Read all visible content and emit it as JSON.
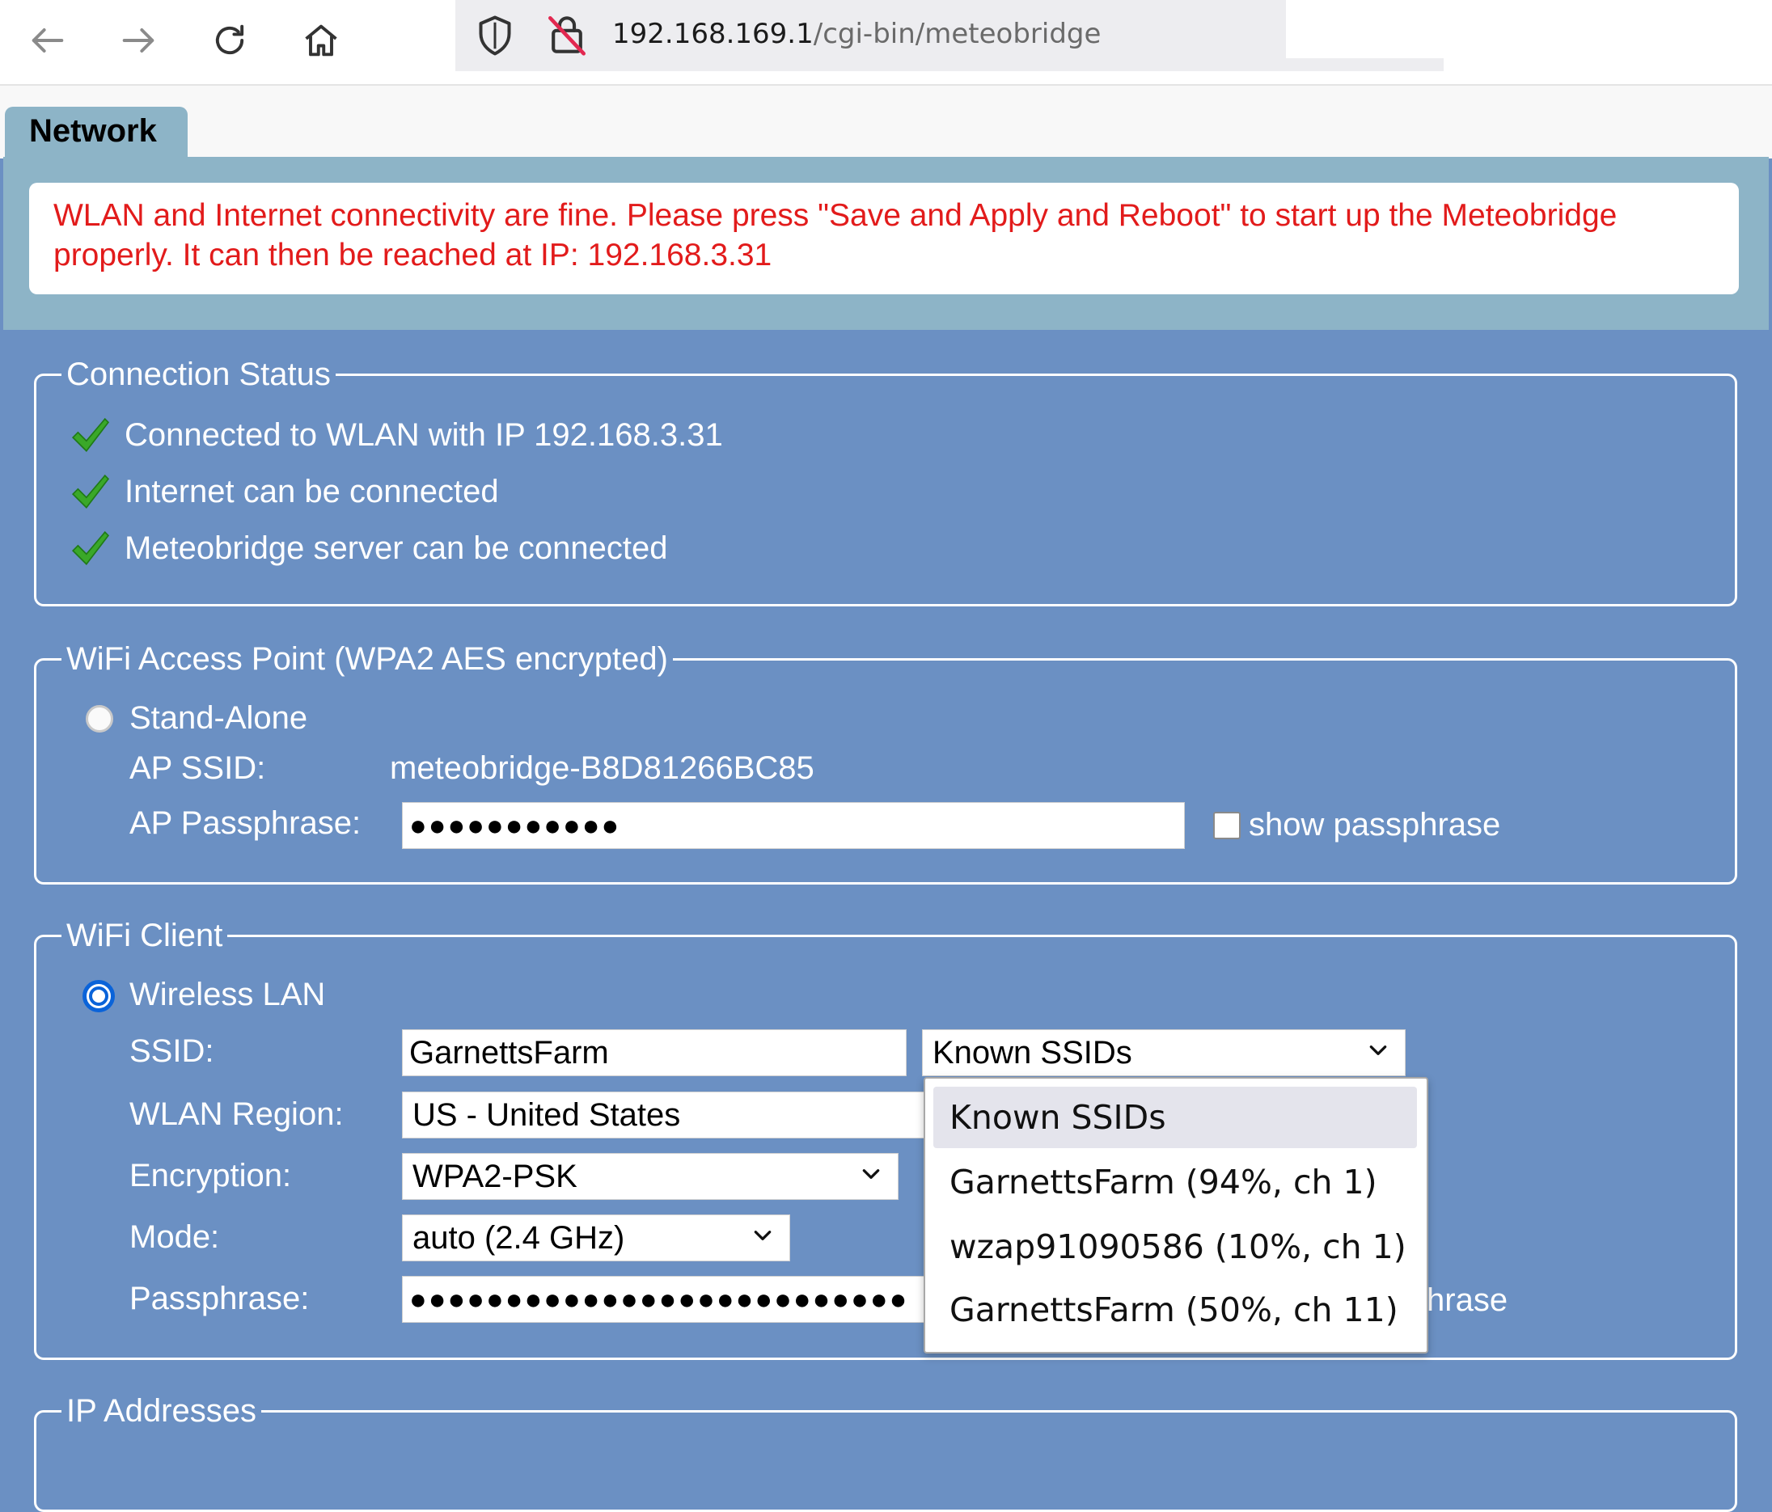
{
  "browser": {
    "url_host": "192.168.169.1",
    "url_path": "/cgi-bin/meteobridge"
  },
  "tab": {
    "label": "Network"
  },
  "alert": {
    "message": "WLAN and Internet connectivity are fine. Please press \"Save and Apply and Reboot\" to start up the Meteobridge properly. It can then be reached at IP: 192.168.3.31"
  },
  "connection_status": {
    "legend": "Connection Status",
    "items": [
      "Connected to WLAN with IP 192.168.3.31",
      "Internet can be connected",
      "Meteobridge server can be connected"
    ]
  },
  "access_point": {
    "legend": "WiFi Access Point (WPA2 AES encrypted)",
    "standalone_label": "Stand-Alone",
    "ssid_label": "AP SSID:",
    "ssid_value": "meteobridge-B8D81266BC85",
    "passphrase_label": "AP Passphrase:",
    "passphrase_value": "●●●●●●●●●●●",
    "show_passphrase_label": "show passphrase"
  },
  "wifi_client": {
    "legend": "WiFi Client",
    "wireless_lan_label": "Wireless LAN",
    "ssid_label": "SSID:",
    "ssid_value": "GarnettsFarm",
    "known_ssids_selected": "Known SSIDs",
    "region_label": "WLAN Region:",
    "region_value": "US - United States",
    "encryption_label": "Encryption:",
    "encryption_value": "WPA2-PSK",
    "mode_label": "Mode:",
    "mode_value": "auto (2.4 GHz)",
    "passphrase_label": "Passphrase:",
    "passphrase_value": "●●●●●●●●●●●●●●●●●●●●●●●●●●",
    "show_passphrase_partial": "hrase",
    "dropdown_options": [
      "Known SSIDs",
      "GarnettsFarm (94%, ch 1)",
      "wzap91090586 (10%, ch 1)",
      "GarnettsFarm (50%, ch 11)"
    ]
  },
  "ip_addresses": {
    "legend": "IP Addresses"
  },
  "colors": {
    "alert_text": "#e21b1b",
    "panel_bg": "#6b90c3",
    "header_bg": "#8db4c7",
    "radio_accent": "#0a63d9"
  }
}
